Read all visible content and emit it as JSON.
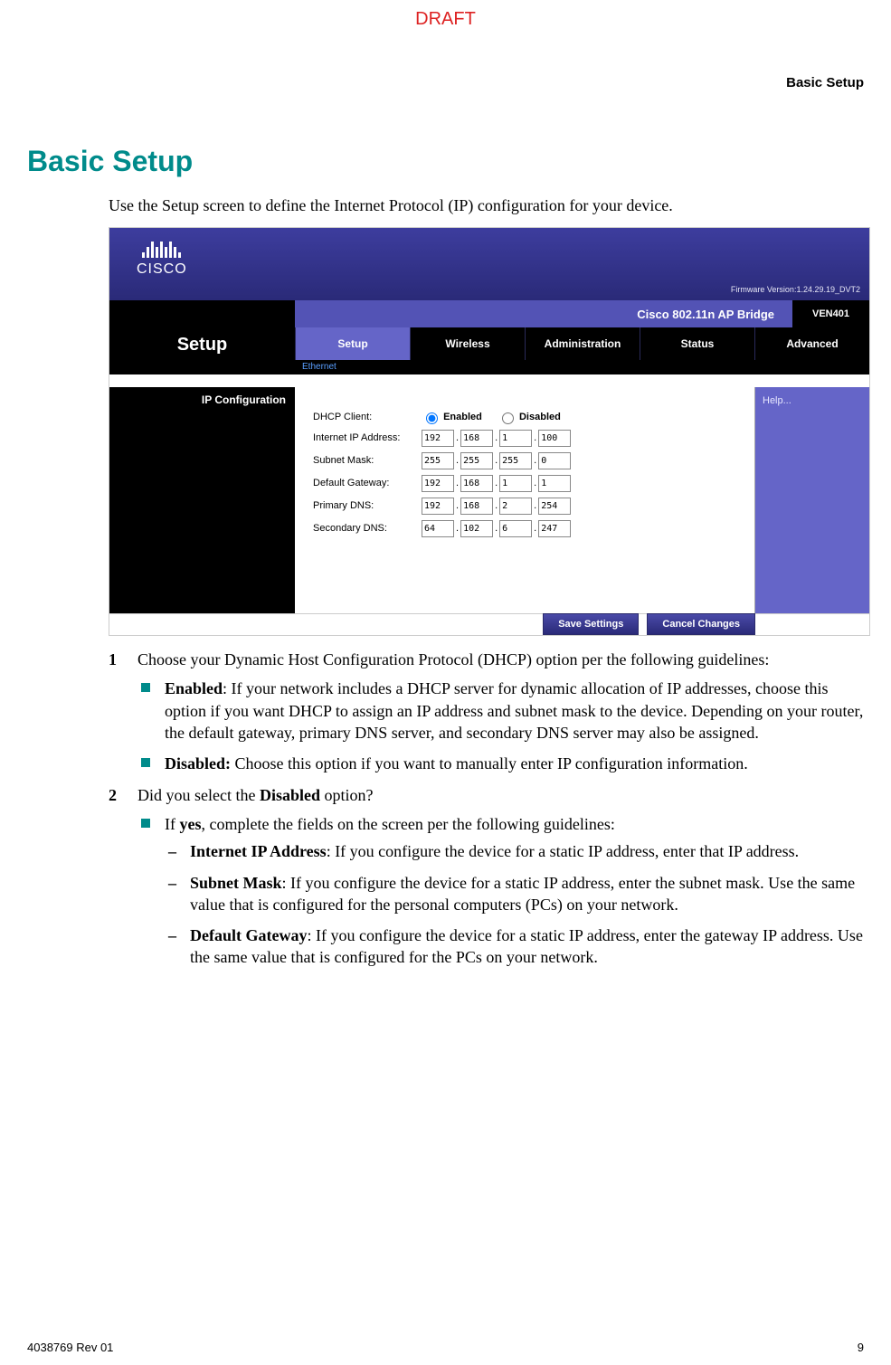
{
  "draft": "DRAFT",
  "headerRight": "Basic Setup",
  "title": "Basic Setup",
  "intro": "Use the Setup screen to define the Internet Protocol (IP) configuration for your device.",
  "ui": {
    "ciscoText": "CISCO",
    "firmware": "Firmware Version:1.24.29.19_DVT2",
    "productTitle": "Cisco 802.11n AP Bridge",
    "model": "VEN401",
    "sectionTitle": "Setup",
    "tabs": [
      "Setup",
      "Wireless",
      "Administration",
      "Status",
      "Advanced"
    ],
    "subnav": "Ethernet",
    "sideLabel": "IP Configuration",
    "helpText": "Help...",
    "form": {
      "dhcpLabel": "DHCP Client:",
      "enabled": "Enabled",
      "disabled": "Disabled",
      "ipLabel": "Internet IP Address:",
      "ip": [
        "192",
        "168",
        "1",
        "100"
      ],
      "maskLabel": "Subnet Mask:",
      "mask": [
        "255",
        "255",
        "255",
        "0"
      ],
      "gwLabel": "Default Gateway:",
      "gw": [
        "192",
        "168",
        "1",
        "1"
      ],
      "dns1Label": "Primary DNS:",
      "dns1": [
        "192",
        "168",
        "2",
        "254"
      ],
      "dns2Label": "Secondary DNS:",
      "dns2": [
        "64",
        "102",
        "6",
        "247"
      ]
    },
    "btnSave": "Save Settings",
    "btnCancel": "Cancel Changes"
  },
  "step1": {
    "lead": "Choose your Dynamic Host Configuration Protocol (DHCP) option per the following guidelines:",
    "enabledLabel": "Enabled",
    "enabledText": ": If your network includes a DHCP server for dynamic allocation of IP addresses, choose this option if you want DHCP to assign an IP address and subnet mask to the device. Depending on your router, the default gateway, primary DNS server, and secondary DNS server may also be assigned.",
    "disabledLabel": "Disabled:",
    "disabledText": " Choose this option if you want to manually enter IP configuration information."
  },
  "step2": {
    "lead1": "Did you select the ",
    "leadBold": "Disabled",
    "lead2": " option?",
    "yes1": "If ",
    "yesBold": "yes",
    "yes2": ", complete the fields on the screen per the following guidelines:",
    "ipLabel": "Internet IP Address",
    "ipText": ": If you configure the device for a static IP address, enter that IP address.",
    "maskLabel": "Subnet Mask",
    "maskText": ": If you configure the device for a static IP address, enter the subnet mask. Use the same value that is configured for the personal computers (PCs) on your network.",
    "gwLabel": "Default Gateway",
    "gwText": ": If you configure the device for a static IP address, enter the gateway IP address. Use the same value that is configured for the PCs on your network."
  },
  "footerLeft": "4038769 Rev 01",
  "footerRight": "9"
}
